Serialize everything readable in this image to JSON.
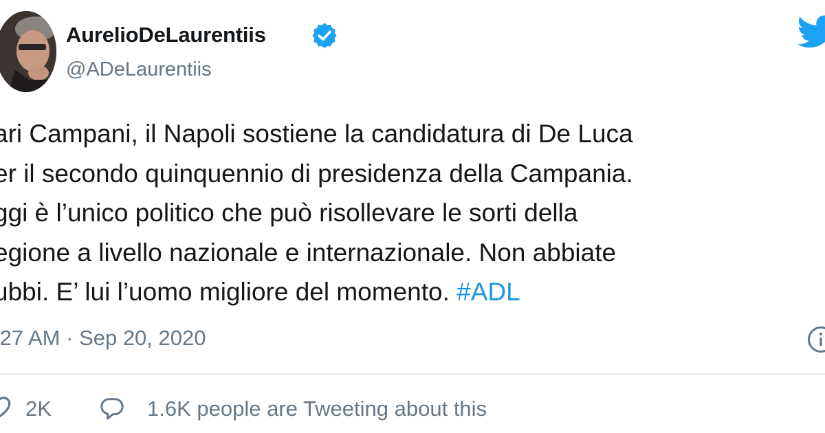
{
  "author": {
    "display_name": "AurelioDeLaurentiis",
    "handle": "@ADeLaurentiis",
    "verified": true
  },
  "tweet": {
    "lines": [
      "ari Campani, il Napoli sostiene la candidatura di De Luca",
      "er il secondo quinquennio di presidenza della Campania.",
      "ggi è l’unico politico che può risollevare le sorti della",
      "egione a livello nazionale e internazionale. Non abbiate",
      "ubbi. E’ lui l’uomo migliore del momento."
    ],
    "hashtag": "#ADL"
  },
  "meta": {
    "timestamp": ":27 AM · Sep 20, 2020"
  },
  "actions": {
    "like_count": "2K",
    "conversation_text": "1.6K people are Tweeting about this"
  },
  "icons": {
    "verified": "verified-badge-icon",
    "brand": "twitter-bird-icon",
    "info": "info-icon",
    "like": "heart-icon",
    "reply": "reply-bubble-icon"
  },
  "colors": {
    "text": "#14171a",
    "secondary": "#657786",
    "accent": "#1b95e0",
    "twitter_blue": "#1da1f2",
    "divider": "#e6ecf0"
  }
}
